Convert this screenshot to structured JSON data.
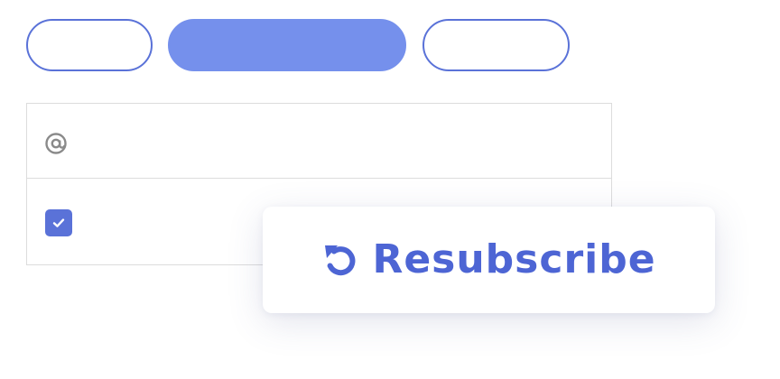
{
  "tabs": [
    {
      "label": ""
    },
    {
      "label": ""
    },
    {
      "label": ""
    }
  ],
  "list": {
    "rows": [
      {
        "icon": "email-at-icon",
        "label": ""
      },
      {
        "icon": "checkbox-checked-icon",
        "label": ""
      }
    ]
  },
  "card": {
    "button_label": "Resubscribe",
    "icon": "refresh-icon"
  },
  "colors": {
    "accent": "#5a72d8",
    "pill_active": "#7590ec",
    "button_text": "#4d65d4",
    "border": "#dcdcdc"
  }
}
